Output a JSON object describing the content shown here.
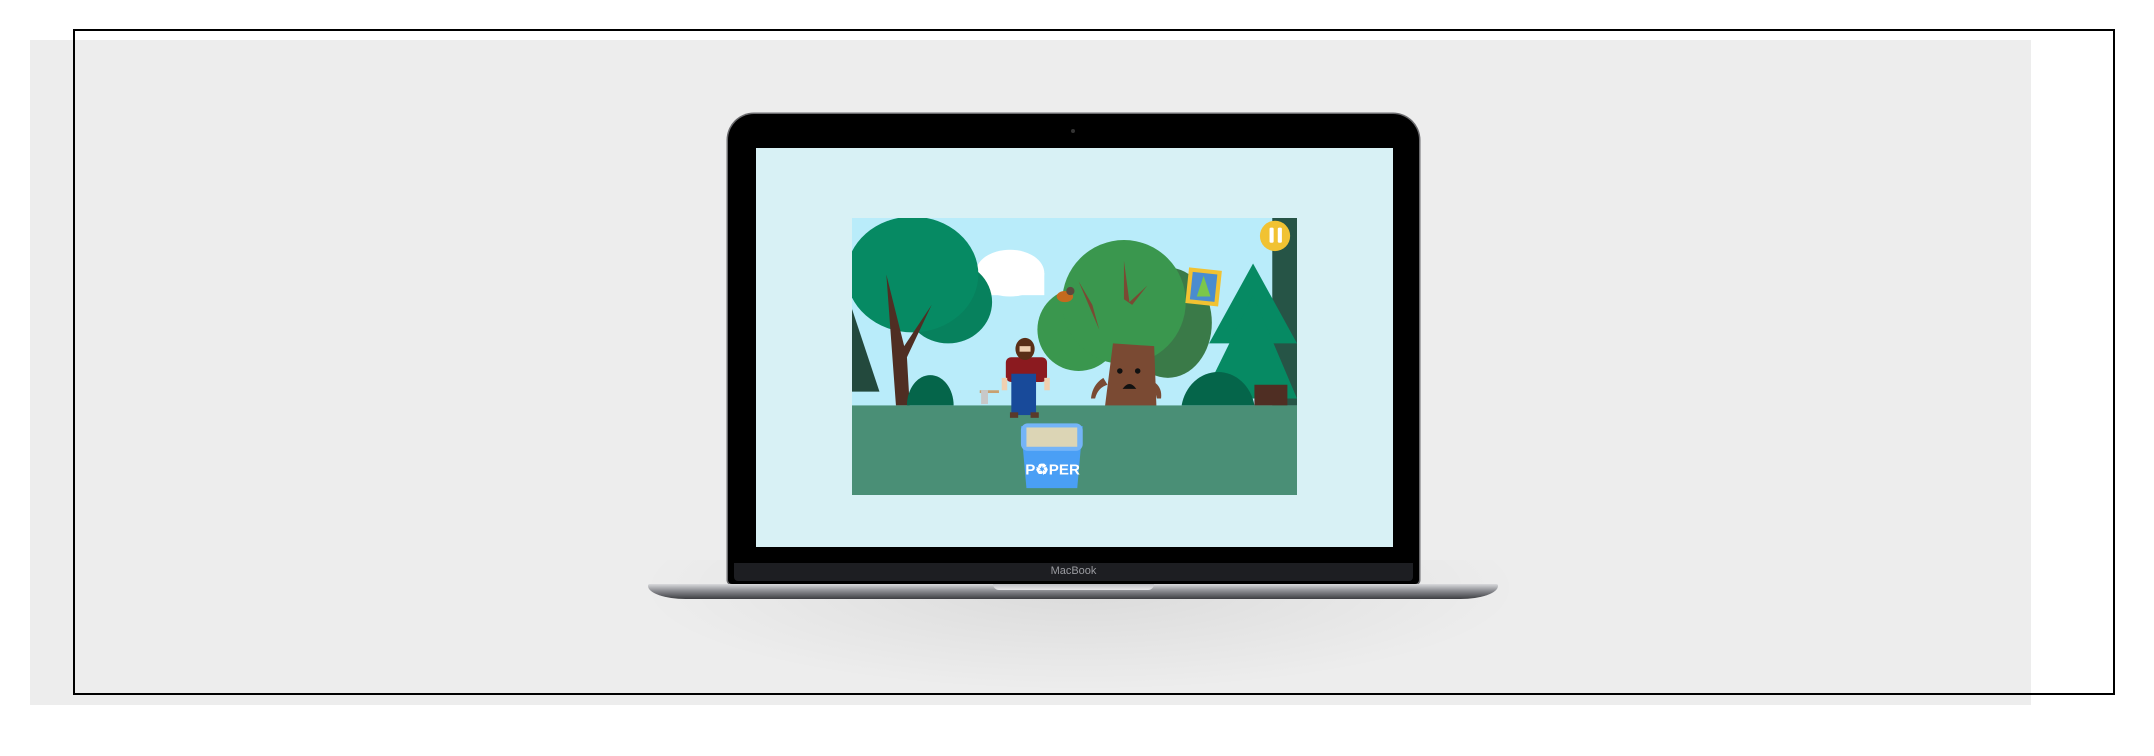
{
  "device": {
    "brand_label": "MacBook"
  },
  "game": {
    "bin_label": "P♻PER",
    "pause_button": {
      "icon": "pause-icon",
      "color": "#f1c232"
    },
    "colors": {
      "sky": "#b9ecfa",
      "ground": "#4a8f76",
      "bin": "#4a9ff5",
      "screen_bg": "#d8f1f5"
    }
  }
}
